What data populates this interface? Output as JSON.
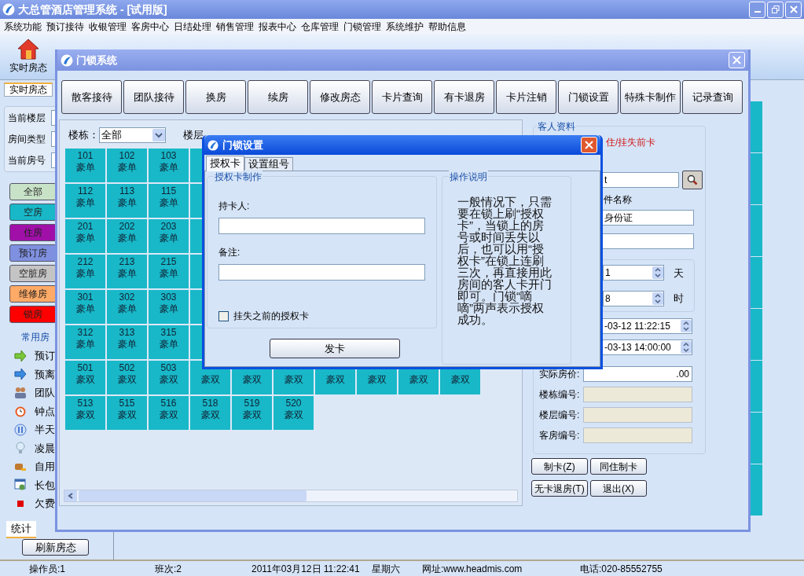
{
  "app": {
    "title": "大总管酒店管理系统 - [试用版]"
  },
  "menu": [
    "系统功能",
    "预订接待",
    "收银管理",
    "客房中心",
    "日结处理",
    "销售管理",
    "报表中心",
    "仓库管理",
    "门锁管理",
    "系统维护",
    "帮助信息"
  ],
  "toolbar": [
    {
      "label": "实时房态"
    }
  ],
  "left_panel": {
    "tab": "实时房态",
    "fields": [
      {
        "label": "当前楼层"
      },
      {
        "label": "房间类型"
      },
      {
        "label": "当前房号"
      }
    ],
    "legend": [
      {
        "label": "全部",
        "color": "#c8e2c8"
      },
      {
        "label": "空房",
        "color": "#18b8c8"
      },
      {
        "label": "住房",
        "color": "#a010a8"
      },
      {
        "label": "预订房",
        "color": "#7f90e0"
      },
      {
        "label": "空脏房",
        "color": "#c4c4c4"
      },
      {
        "label": "维修房",
        "color": "#ffaa66"
      },
      {
        "label": "锁房",
        "color": "#ff0000"
      }
    ],
    "quick_title": "常用房",
    "quick": [
      "预订",
      "预离",
      "团队",
      "钟点",
      "半天",
      "凌晨",
      "自用",
      "长包",
      "欠费"
    ],
    "bottom_tab": "统计",
    "refresh_button": "刷新房态"
  },
  "lock_window": {
    "title": "门锁系统",
    "buttons": [
      "散客接待",
      "团队接待",
      "换房",
      "续房",
      "修改房态",
      "卡片查询",
      "有卡退房",
      "卡片注销",
      "门锁设置",
      "特殊卡制作",
      "记录查询"
    ],
    "filter": {
      "building_label": "楼栋：",
      "building_value": "全部",
      "floor_label": "楼层"
    },
    "room_rows": [
      [
        {
          "number": "101",
          "type": "豪单"
        },
        {
          "number": "102",
          "type": "豪单"
        },
        {
          "number": "103",
          "type": "豪单"
        }
      ],
      [
        {
          "number": "112",
          "type": "豪单"
        },
        {
          "number": "113",
          "type": "豪单"
        },
        {
          "number": "115",
          "type": "豪单"
        }
      ],
      [
        {
          "number": "201",
          "type": "豪单"
        },
        {
          "number": "202",
          "type": "豪单"
        },
        {
          "number": "203",
          "type": "豪单"
        }
      ],
      [
        {
          "number": "212",
          "type": "豪单"
        },
        {
          "number": "213",
          "type": "豪单"
        },
        {
          "number": "215",
          "type": "豪单"
        }
      ],
      [
        {
          "number": "301",
          "type": "豪单"
        },
        {
          "number": "302",
          "type": "豪单"
        },
        {
          "number": "303",
          "type": "豪单"
        }
      ],
      [
        {
          "number": "312",
          "type": "豪单"
        },
        {
          "number": "313",
          "type": "豪单"
        },
        {
          "number": "315",
          "type": "豪单"
        }
      ],
      [
        {
          "number": "501",
          "type": "豪双"
        },
        {
          "number": "502",
          "type": "豪双"
        },
        {
          "number": "503",
          "type": "豪双"
        },
        {
          "type": "豪双"
        },
        {
          "type": "豪双"
        },
        {
          "type": "豪双"
        },
        {
          "type": "豪双"
        },
        {
          "type": "豪双"
        },
        {
          "type": "豪双"
        },
        {
          "type": "豪双"
        }
      ],
      [
        {
          "number": "513",
          "type": "豪双"
        },
        {
          "number": "515",
          "type": "豪双"
        },
        {
          "number": "516",
          "type": "豪双"
        },
        {
          "number": "518",
          "type": "豪双"
        },
        {
          "number": "519",
          "type": "豪双"
        },
        {
          "number": "520",
          "type": "豪双"
        }
      ]
    ],
    "guest": {
      "group_title": "客人资料",
      "notice": "住/挂失前卡",
      "search_value": "t",
      "id_label": "件名称",
      "id_value": "身份证",
      "days": "1",
      "days_unit": "天",
      "hours": "8",
      "hours_unit": "时",
      "arrival": "-03-12 11:22:15",
      "departure": "-03-13 14:00:00",
      "price_label": "实际房价:",
      "price": ".00",
      "codes": [
        "楼栋编号:",
        "楼层编号:",
        "客房编号:"
      ]
    },
    "actions": [
      "制卡(Z)",
      "同住制卡",
      "无卡退房(T)",
      "退出(X)"
    ]
  },
  "settings_dialog": {
    "title": "门锁设置",
    "tabs": [
      {
        "label": "授权卡",
        "selected": true
      },
      {
        "label": "设置组号",
        "selected": false
      }
    ],
    "group_title": "授权卡制作",
    "holder_label": "持卡人:",
    "note_label": "备注:",
    "lost_checkbox": {
      "label": "挂失之前的授权卡",
      "checked": false
    },
    "issue_button": "发卡",
    "help_title": "操作说明",
    "help_text": "一般情况下，只需要在锁上刷“授权卡”，当锁上的房号或时间丢失以后，也可以用“授权卡”在锁上连刷三次，再直接用此房间的客人卡开门即可。门锁“嘀嘀”两声表示授权成功。"
  },
  "status_bar": [
    "操作员:1",
    "班次:2",
    "2011年03月12日 11:22:41",
    "星期六",
    "网址:www.headmis.com",
    "电话:020-85552755"
  ]
}
